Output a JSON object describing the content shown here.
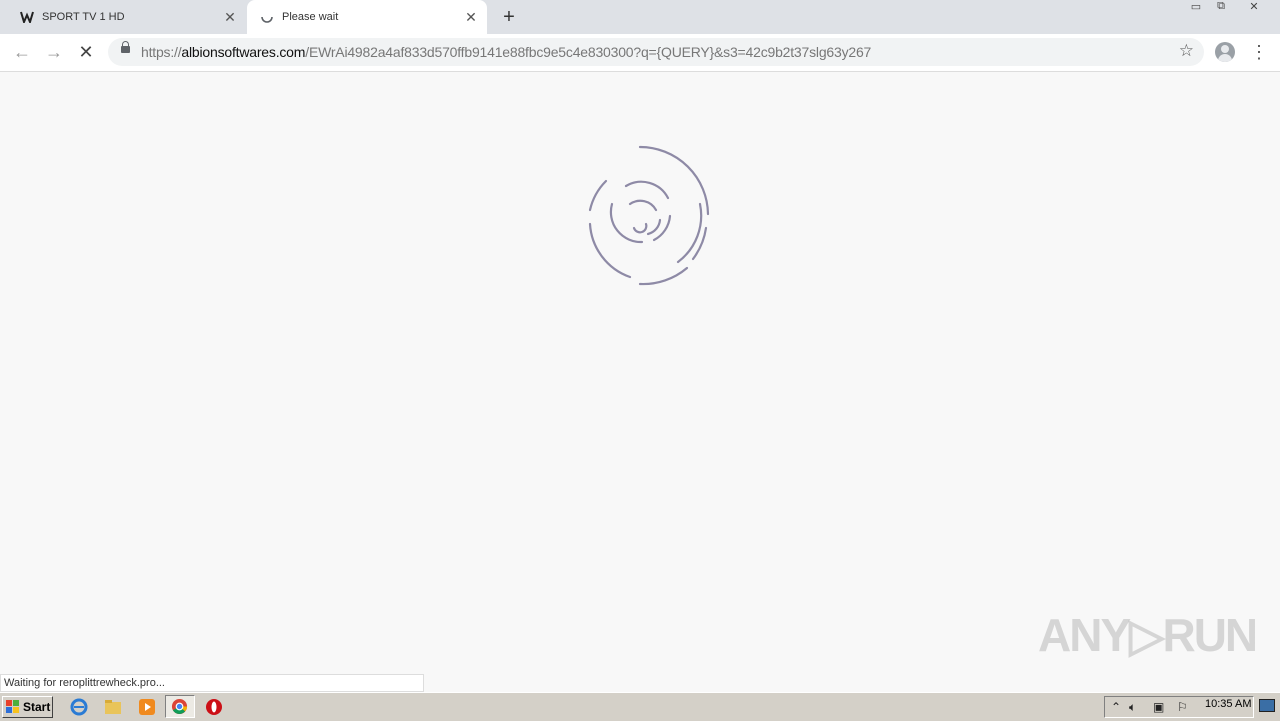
{
  "tabs": [
    {
      "title": "SPORT TV 1 HD",
      "close": "✕"
    },
    {
      "title": "Please wait",
      "close": "✕"
    }
  ],
  "new_tab": "+",
  "window_controls": {
    "minimize": "▭",
    "restore": "⧉",
    "close": "✕"
  },
  "omnibox": {
    "scheme": "https://",
    "host": "albionsoftwares.com",
    "path": "/EWrAi4982a4af833d570ffb9141e88fbc9e5c4e830300?q={QUERY}&s3=42c9b2t37slg63y267"
  },
  "nav": {
    "back": "←",
    "forward": "→",
    "stop": "✕"
  },
  "status_text": "Waiting for reroplittrewheck.pro...",
  "watermark": "ANY▷RUN",
  "taskbar": {
    "start_label": "Start",
    "clock": "10:35 AM"
  },
  "colors": {
    "spinner": "#8e8aa6",
    "page_bg": "#f8f8f8",
    "tabbar": "#dee1e6"
  }
}
